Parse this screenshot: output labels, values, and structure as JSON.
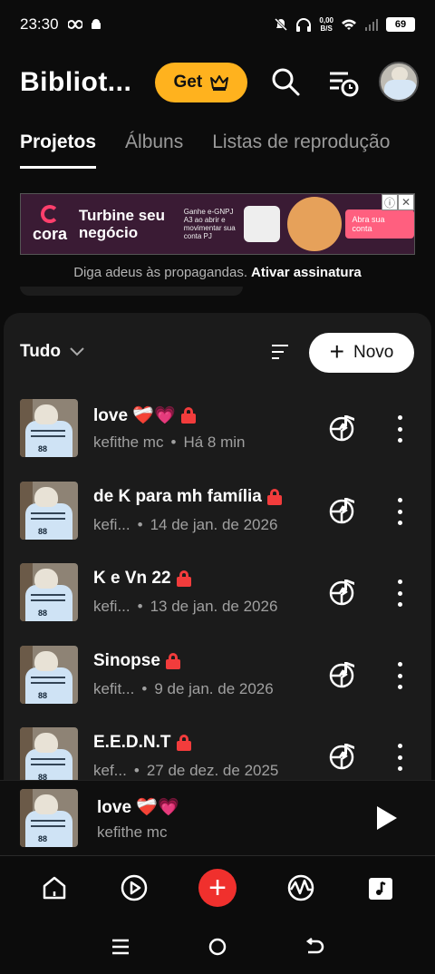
{
  "status": {
    "time": "23:30",
    "speed_top": "0,00",
    "speed_bottom": "B/S",
    "battery": "69"
  },
  "header": {
    "title": "Bibliot...",
    "get_label": "Get"
  },
  "tabs": [
    {
      "label": "Projetos",
      "active": true
    },
    {
      "label": "Álbuns",
      "active": false
    },
    {
      "label": "Listas de reprodução",
      "active": false
    }
  ],
  "ad": {
    "brand": "cora",
    "headline": "Turbine seu negócio",
    "small": "Ganhe e-GNPJ A3 ao abrir e movimentar sua conta PJ",
    "cta": "Abra sua conta"
  },
  "noads": {
    "text": "Diga adeus às propagandas.",
    "link": "Ativar assinatura"
  },
  "toolbar": {
    "filter_label": "Tudo",
    "new_label": "Novo"
  },
  "projects": [
    {
      "title": "love ❤️‍🩹💗",
      "artist": "kefithe mc",
      "date": "Há 8 min"
    },
    {
      "title": "de K para mh família",
      "artist": "kefi...",
      "date": "14 de jan. de 2026"
    },
    {
      "title": "K e Vn 22",
      "artist": "kefi...",
      "date": "13 de jan. de 2026"
    },
    {
      "title": "Sinopse",
      "artist": "kefit...",
      "date": "9 de jan. de 2026"
    },
    {
      "title": "E.E.D.N.T",
      "artist": "kef...",
      "date": "27 de dez. de 2025"
    }
  ],
  "thumb_text": "88",
  "player": {
    "title": "love ❤️‍🩹💗",
    "artist": "kefithe mc"
  },
  "colors": {
    "accent_get": "#ffb21e",
    "create": "#f0302d",
    "lock": "#f23c3c"
  }
}
